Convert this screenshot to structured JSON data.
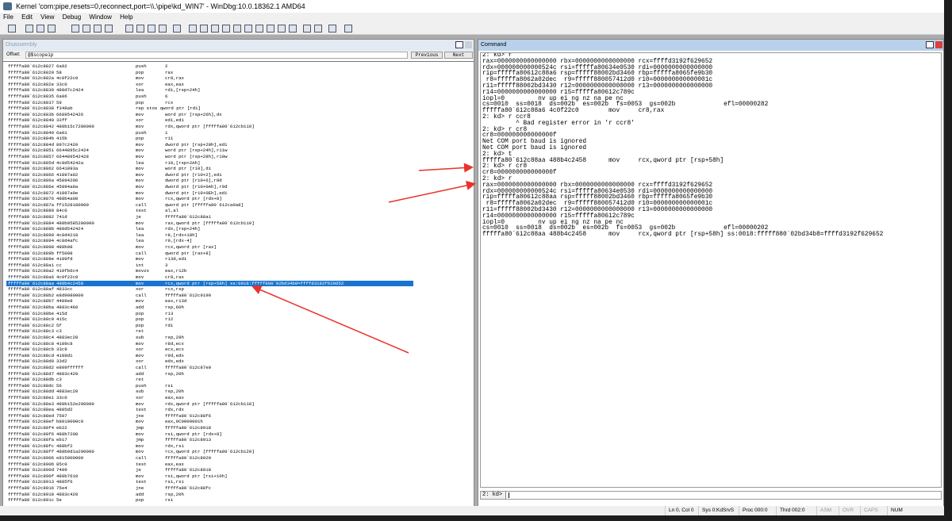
{
  "window": {
    "title": "Kernel 'com:pipe,resets=0,reconnect,port=\\\\.\\pipe\\kd_WIN7' - WinDbg:10.0.18362.1 AMD64"
  },
  "menu": [
    "File",
    "Edit",
    "View",
    "Debug",
    "Window",
    "Help"
  ],
  "disassembly": {
    "title": "Disassembly",
    "offset_label": "Offset:",
    "offset_value": "@$scopeip",
    "previous_label": "Previous",
    "next_label": "Next",
    "selected_index": 36,
    "rows": [
      [
        "fffffa80`612c8827",
        "6a02",
        "push",
        "2"
      ],
      [
        "fffffa80`612c8829",
        "58",
        "pop",
        "rax"
      ],
      [
        "fffffa80`612c882a",
        "4c0f22c0",
        "mov",
        "cr8,rax"
      ],
      [
        "fffffa80`612c882e",
        "33c0",
        "xor",
        "eax,eax"
      ],
      [
        "fffffa80`612c8830",
        "488d7c2424",
        "lea",
        "rdi,[rsp+24h]"
      ],
      [
        "fffffa80`612c8835",
        "6a06",
        "push",
        "6"
      ],
      [
        "fffffa80`612c8837",
        "59",
        "pop",
        "rcx"
      ],
      [
        "fffffa80`612c8838",
        "f348ab",
        "rep stos qword ptr [rdi]",
        ""
      ],
      [
        "fffffa80`612c883b",
        "6689542426",
        "mov",
        "word ptr [rsp+26h],dx"
      ],
      [
        "fffffa80`612c8840",
        "33ff",
        "xor",
        "edi,edi"
      ],
      [
        "fffffa80`612c8842",
        "488b15c7280000",
        "mov",
        "rdx,qword ptr [fffffa80`612cb110]"
      ],
      [
        "fffffa80`612c8849",
        "6a01",
        "push",
        "1"
      ],
      [
        "fffffa80`612c884b",
        "415b",
        "pop",
        "r11"
      ],
      [
        "fffffa80`612c884d",
        "897c2420",
        "mov",
        "dword ptr [rsp+20h],edi"
      ],
      [
        "fffffa80`612c8851",
        "6644895c2424",
        "mov",
        "word ptr [rsp+24h],r11w"
      ],
      [
        "fffffa80`612c8857",
        "664489542428",
        "mov",
        "word ptr [rsp+28h],r10w"
      ],
      [
        "fffffa80`612c885d",
        "4c8d54242a",
        "lea",
        "r10,[rsp+2Ah]"
      ],
      [
        "fffffa80`612c8862",
        "6641893a",
        "mov",
        "word ptr [r10],di"
      ],
      [
        "fffffa80`612c8866",
        "41897a02",
        "mov",
        "dword ptr [r10+2],edi"
      ],
      [
        "fffffa80`612c886a",
        "45894206",
        "mov",
        "dword ptr [r10+6],r8d"
      ],
      [
        "fffffa80`612c886e",
        "45894a0a",
        "mov",
        "dword ptr [r10+0Ah],r9d"
      ],
      [
        "fffffa80`612c8872",
        "41897a0e",
        "mov",
        "dword ptr [r10+0Eh],edi"
      ],
      [
        "fffffa80`612c8876",
        "488b4a08",
        "mov",
        "rcx,qword ptr [rdx+8]"
      ],
      [
        "fffffa80`612c887a",
        "ff1528180000",
        "call",
        "qword ptr [fffffa80`612ca0a8]"
      ],
      [
        "fffffa80`612c8880",
        "84c0",
        "test",
        "al,al"
      ],
      [
        "fffffa80`612c8882",
        "741d",
        "je",
        "fffffa80`612c88a1"
      ],
      [
        "fffffa80`612c8884",
        "488b0585280000",
        "mov",
        "rax,qword ptr [fffffa80`612cb110]"
      ],
      [
        "fffffa80`612c888b",
        "488d542424",
        "lea",
        "rdx,[rsp+24h]"
      ],
      [
        "fffffa80`612c8890",
        "4c8d4218",
        "lea",
        "r8,[rdx+18h]"
      ],
      [
        "fffffa80`612c8894",
        "4c8d4afc",
        "lea",
        "r9,[rdx-4]"
      ],
      [
        "fffffa80`612c8898",
        "488b08",
        "mov",
        "rcx,qword ptr [rax]"
      ],
      [
        "fffffa80`612c889b",
        "ff5008",
        "call",
        "qword ptr [rax+8]"
      ],
      [
        "fffffa80`612c889e",
        "4189fd",
        "mov",
        "r13d,edi"
      ],
      [
        "fffffa80`612c88a1",
        "cc",
        "int",
        "3"
      ],
      [
        "fffffa80`612c88a2",
        "410fb6c4",
        "movzx",
        "eax,r12b"
      ],
      [
        "fffffa80`612c88a6",
        "4c0f22c0",
        "mov",
        "cr8,rax"
      ],
      [
        "fffffa80`612c88aa",
        "488b4c2458",
        "mov",
        "rcx,qword ptr [rsp+58h] ss:0018:fffff880`02bd34b8=ffffd3192f629652"
      ],
      [
        "fffffa80`612c88af",
        "4833cc",
        "xor",
        "rcx,rsp"
      ],
      [
        "fffffa80`612c88b2",
        "e8d9080000",
        "call",
        "fffffa80`612c9190"
      ],
      [
        "fffffa80`612c88b7",
        "4489e8",
        "mov",
        "eax,r13d"
      ],
      [
        "fffffa80`612c88ba",
        "4883c460",
        "add",
        "rsp,60h"
      ],
      [
        "fffffa80`612c88be",
        "415d",
        "pop",
        "r13"
      ],
      [
        "fffffa80`612c88c0",
        "415c",
        "pop",
        "r12"
      ],
      [
        "fffffa80`612c88c2",
        "5f",
        "pop",
        "rdi"
      ],
      [
        "fffffa80`612c88c3",
        "c3",
        "ret",
        ""
      ],
      [
        "fffffa80`612c88c4",
        "4883ec28",
        "sub",
        "rsp,28h"
      ],
      [
        "fffffa80`612c88c8",
        "4189c8",
        "mov",
        "r8d,ecx"
      ],
      [
        "fffffa80`612c88cb",
        "33c9",
        "xor",
        "ecx,ecx"
      ],
      [
        "fffffa80`612c88cd",
        "4189d1",
        "mov",
        "r9d,edx"
      ],
      [
        "fffffa80`612c88d0",
        "33d2",
        "xor",
        "edx,edx"
      ],
      [
        "fffffa80`612c88d2",
        "e809ffffff",
        "call",
        "fffffa80`612c87e0"
      ],
      [
        "fffffa80`612c88d7",
        "4883c420",
        "add",
        "rsp,20h"
      ],
      [
        "fffffa80`612c88db",
        "c3",
        "ret",
        ""
      ],
      [
        "fffffa80`612c88dc",
        "56",
        "push",
        "rsi"
      ],
      [
        "fffffa80`612c88dd",
        "4883ec20",
        "sub",
        "rsp,20h"
      ],
      [
        "fffffa80`612c88e1",
        "33c0",
        "xor",
        "eax,eax"
      ],
      [
        "fffffa80`612c88e3",
        "488b152e290000",
        "mov",
        "rdx,qword ptr [fffffa80`612cb118]"
      ],
      [
        "fffffa80`612c88ea",
        "4885d2",
        "test",
        "rdx,rdx"
      ],
      [
        "fffffa80`612c88ed",
        "7507",
        "jne",
        "fffffa80`612c88f6"
      ],
      [
        "fffffa80`612c88ef",
        "b8010000c0",
        "mov",
        "eax,0C0000001h"
      ],
      [
        "fffffa80`612c88f4",
        "eb22",
        "jmp",
        "fffffa80`612c8918"
      ],
      [
        "fffffa80`612c88f6",
        "488b7208",
        "mov",
        "rsi,qword ptr [rdx+8]"
      ],
      [
        "fffffa80`612c88fa",
        "eb17",
        "jmp",
        "fffffa80`612c8913"
      ],
      [
        "fffffa80`612c88fc",
        "488bf2",
        "mov",
        "rdx,rsi"
      ],
      [
        "fffffa80`612c88ff",
        "488b0d1a290000",
        "mov",
        "rcx,qword ptr [fffffa80`612cb120]"
      ],
      [
        "fffffa80`612c8906",
        "e815000000",
        "call",
        "fffffa80`612c8920"
      ],
      [
        "fffffa80`612c890b",
        "85c0",
        "test",
        "eax,eax"
      ],
      [
        "fffffa80`612c890d",
        "7409",
        "je",
        "fffffa80`612c8918"
      ],
      [
        "fffffa80`612c890f",
        "488b7610",
        "mov",
        "rsi,qword ptr [rsi+10h]"
      ],
      [
        "fffffa80`612c8913",
        "4885f6",
        "test",
        "rsi,rsi"
      ],
      [
        "fffffa80`612c8916",
        "75e4",
        "jne",
        "fffffa80`612c88fc"
      ],
      [
        "fffffa80`612c8918",
        "4883c420",
        "add",
        "rsp,20h"
      ],
      [
        "fffffa80`612c891c",
        "5e",
        "pop",
        "rsi"
      ]
    ]
  },
  "command": {
    "title": "Command",
    "prompt": "2: kd>",
    "input_value": "",
    "lines": [
      "2: kd> r",
      "rax=0000000000000000 rbx=0000000000000000 rcx=ffffd3192f629652",
      "rdx=000000000000524c rsi=fffffa80634e0530 rdi=0000000000000000",
      "rip=fffffa80612c88a6 rsp=fffff88002bd3460 rbp=fffffa8065fe9b30",
      " r8=fffffa8062a02dec  r9=fffff880057412d0 r10=000000000000001c",
      "r11=fffff88002bd3430 r12=0000000000000000 r13=0000000000000000",
      "r14=0000000000000000 r15=fffffa80612c789c",
      "iopl=0         nv up ei ng nz na pe nc",
      "cs=0010  ss=0018  ds=002b  es=002b  fs=0053  gs=002b             efl=00000282",
      "fffffa80`612c88a6 4c0f22c0        mov     cr8,rax",
      "2: kd> r ccr8",
      "         ^ Bad register error in 'r ccr8'",
      "2: kd> r cr8",
      "cr8=000000000000000f",
      "Net COM port baud is ignored",
      "Net COM port baud is ignored",
      "2: kd> t",
      "fffffa80`612c88aa 488b4c2458      mov     rcx,qword ptr [rsp+58h]",
      "2: kd> r cr8",
      "cr8=000000000000000f",
      "2: kd> r",
      "rax=0000000000000000 rbx=0000000000000000 rcx=ffffd3192f629652",
      "rdx=000000000000524c rsi=fffffa80634e0530 rdi=0000000000000000",
      "rip=fffffa80612c88aa rsp=fffff88002bd3460 rbp=fffffa8065fe9b30",
      " r8=fffffa8062a02dec  r9=fffff880057412d0 r10=000000000000001c",
      "r11=fffff88002bd3430 r12=0000000000000000 r13=0000000000000000",
      "r14=0000000000000000 r15=fffffa80612c789c",
      "iopl=0         nv up ei ng nz na pe nc",
      "cs=0010  ss=0018  ds=002b  es=002b  fs=0053  gs=002b             efl=00000202",
      "fffffa80`612c88aa 488b4c2458      mov     rcx,qword ptr [rsp+58h] ss:0018:fffff880`02bd34b8=ffffd3192f629652"
    ]
  },
  "statusbar": [
    "Ln 0, Col 0",
    "Sys 0:KdSrvS",
    "Proc 000:0",
    "Thrd 002:0",
    "ASM",
    "OVR",
    "CAPS",
    "NUM"
  ],
  "colors": {
    "selection": "#1874d0",
    "annotation_arrow": "#e8322a",
    "command_title": "#b9d1ea"
  }
}
